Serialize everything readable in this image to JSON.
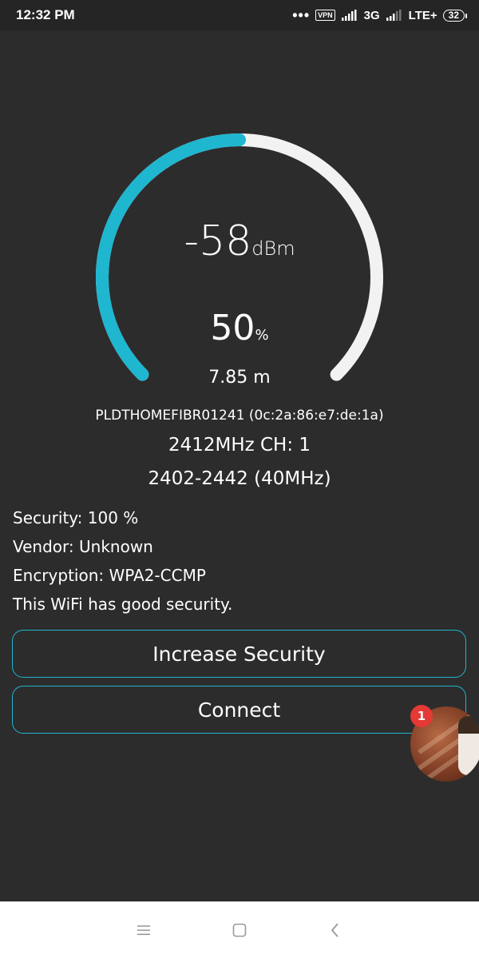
{
  "status_bar": {
    "time": "12:32 PM",
    "dots": "•••",
    "vpn": "VPN",
    "net1": "3G",
    "net2": "LTE+",
    "battery": "32"
  },
  "gauge": {
    "rssi_value": "-58",
    "rssi_unit": "dBm",
    "percent_value": "50",
    "percent_unit": "%",
    "distance": "7.85 m",
    "level_fraction": 0.5,
    "fill_color": "#1fb6d0",
    "track_color": "#f2f2f2"
  },
  "network": {
    "ssid_line": "PLDTHOMEFIBR01241 (0c:2a:86:e7:de:1a)",
    "freq_line": "2412MHz  CH: 1",
    "range_line": "2402-2442 (40MHz)"
  },
  "info": {
    "security": "Security: 100 %",
    "vendor": "Vendor: Unknown",
    "encryption": "Encryption: WPA2-CCMP",
    "note": "This WiFi has good security."
  },
  "buttons": {
    "increase_security": "Increase Security",
    "connect": "Connect"
  },
  "chat_head": {
    "badge_count": "1"
  },
  "nav": {
    "menu_icon": "menu-icon",
    "home_icon": "home-icon",
    "back_icon": "back-icon"
  },
  "colors": {
    "background": "#2c2c2c",
    "accent": "#1fb6d0",
    "badge": "#e53935"
  }
}
